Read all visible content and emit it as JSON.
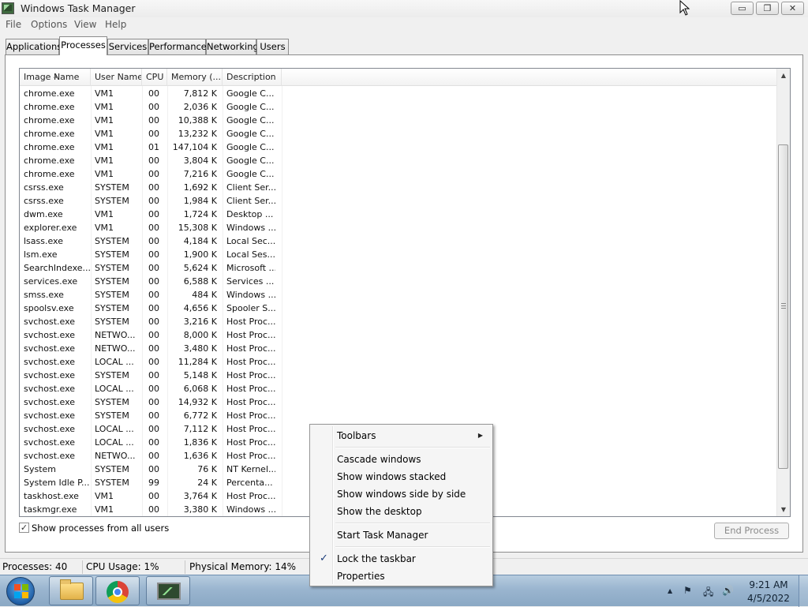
{
  "window": {
    "title": "Windows Task Manager",
    "minimize_label": "▭",
    "restore_label": "❐",
    "close_label": "✕"
  },
  "menu": [
    "File",
    "Options",
    "View",
    "Help"
  ],
  "tabs": [
    "Applications",
    "Processes",
    "Services",
    "Performance",
    "Networking",
    "Users"
  ],
  "active_tab": "Processes",
  "columns": [
    "Image Name",
    "User Name",
    "CPU",
    "Memory (...",
    "Description"
  ],
  "processes": [
    {
      "name": "chrome.exe",
      "user": "VM1",
      "cpu": "00",
      "mem": "7,812 K",
      "desc": "Google C..."
    },
    {
      "name": "chrome.exe",
      "user": "VM1",
      "cpu": "00",
      "mem": "2,036 K",
      "desc": "Google C..."
    },
    {
      "name": "chrome.exe",
      "user": "VM1",
      "cpu": "00",
      "mem": "10,388 K",
      "desc": "Google C..."
    },
    {
      "name": "chrome.exe",
      "user": "VM1",
      "cpu": "00",
      "mem": "13,232 K",
      "desc": "Google C..."
    },
    {
      "name": "chrome.exe",
      "user": "VM1",
      "cpu": "01",
      "mem": "147,104 K",
      "desc": "Google C..."
    },
    {
      "name": "chrome.exe",
      "user": "VM1",
      "cpu": "00",
      "mem": "3,804 K",
      "desc": "Google C..."
    },
    {
      "name": "chrome.exe",
      "user": "VM1",
      "cpu": "00",
      "mem": "7,216 K",
      "desc": "Google C..."
    },
    {
      "name": "csrss.exe",
      "user": "SYSTEM",
      "cpu": "00",
      "mem": "1,692 K",
      "desc": "Client Ser..."
    },
    {
      "name": "csrss.exe",
      "user": "SYSTEM",
      "cpu": "00",
      "mem": "1,984 K",
      "desc": "Client Ser..."
    },
    {
      "name": "dwm.exe",
      "user": "VM1",
      "cpu": "00",
      "mem": "1,724 K",
      "desc": "Desktop ..."
    },
    {
      "name": "explorer.exe",
      "user": "VM1",
      "cpu": "00",
      "mem": "15,308 K",
      "desc": "Windows ..."
    },
    {
      "name": "lsass.exe",
      "user": "SYSTEM",
      "cpu": "00",
      "mem": "4,184 K",
      "desc": "Local Sec..."
    },
    {
      "name": "lsm.exe",
      "user": "SYSTEM",
      "cpu": "00",
      "mem": "1,900 K",
      "desc": "Local Ses..."
    },
    {
      "name": "SearchIndexe...",
      "user": "SYSTEM",
      "cpu": "00",
      "mem": "5,624 K",
      "desc": "Microsoft ..."
    },
    {
      "name": "services.exe",
      "user": "SYSTEM",
      "cpu": "00",
      "mem": "6,588 K",
      "desc": "Services ..."
    },
    {
      "name": "smss.exe",
      "user": "SYSTEM",
      "cpu": "00",
      "mem": "484 K",
      "desc": "Windows ..."
    },
    {
      "name": "spoolsv.exe",
      "user": "SYSTEM",
      "cpu": "00",
      "mem": "4,656 K",
      "desc": "Spooler S..."
    },
    {
      "name": "svchost.exe",
      "user": "SYSTEM",
      "cpu": "00",
      "mem": "3,216 K",
      "desc": "Host Proc..."
    },
    {
      "name": "svchost.exe",
      "user": "NETWO...",
      "cpu": "00",
      "mem": "8,000 K",
      "desc": "Host Proc..."
    },
    {
      "name": "svchost.exe",
      "user": "NETWO...",
      "cpu": "00",
      "mem": "3,480 K",
      "desc": "Host Proc..."
    },
    {
      "name": "svchost.exe",
      "user": "LOCAL ...",
      "cpu": "00",
      "mem": "11,284 K",
      "desc": "Host Proc..."
    },
    {
      "name": "svchost.exe",
      "user": "SYSTEM",
      "cpu": "00",
      "mem": "5,148 K",
      "desc": "Host Proc..."
    },
    {
      "name": "svchost.exe",
      "user": "LOCAL ...",
      "cpu": "00",
      "mem": "6,068 K",
      "desc": "Host Proc..."
    },
    {
      "name": "svchost.exe",
      "user": "SYSTEM",
      "cpu": "00",
      "mem": "14,932 K",
      "desc": "Host Proc..."
    },
    {
      "name": "svchost.exe",
      "user": "SYSTEM",
      "cpu": "00",
      "mem": "6,772 K",
      "desc": "Host Proc..."
    },
    {
      "name": "svchost.exe",
      "user": "LOCAL ...",
      "cpu": "00",
      "mem": "7,112 K",
      "desc": "Host Proc..."
    },
    {
      "name": "svchost.exe",
      "user": "LOCAL ...",
      "cpu": "00",
      "mem": "1,836 K",
      "desc": "Host Proc..."
    },
    {
      "name": "svchost.exe",
      "user": "NETWO...",
      "cpu": "00",
      "mem": "1,636 K",
      "desc": "Host Proc..."
    },
    {
      "name": "System",
      "user": "SYSTEM",
      "cpu": "00",
      "mem": "76 K",
      "desc": "NT Kernel..."
    },
    {
      "name": "System Idle P...",
      "user": "SYSTEM",
      "cpu": "99",
      "mem": "24 K",
      "desc": "Percenta..."
    },
    {
      "name": "taskhost.exe",
      "user": "VM1",
      "cpu": "00",
      "mem": "3,764 K",
      "desc": "Host Proc..."
    },
    {
      "name": "taskmgr.exe",
      "user": "VM1",
      "cpu": "00",
      "mem": "3,380 K",
      "desc": "Windows ..."
    }
  ],
  "show_all_users": {
    "label": "Show processes from all users",
    "checked": true,
    "check_glyph": "✓"
  },
  "end_process_label": "End Process",
  "status": {
    "processes": "Processes: 40",
    "cpu": "CPU Usage: 1%",
    "memory": "Physical Memory: 14%"
  },
  "context_menu": {
    "toolbars": "Toolbars",
    "submenu_arrow": "▶",
    "cascade": "Cascade windows",
    "stacked": "Show windows stacked",
    "side_by_side": "Show windows side by side",
    "desktop": "Show the desktop",
    "task_manager": "Start Task Manager",
    "lock": "Lock the taskbar",
    "lock_checked": true,
    "check_glyph": "✓",
    "properties": "Properties"
  },
  "taskbar": {
    "time": "9:21 AM",
    "date": "4/5/2022",
    "tray_arrow": "▲",
    "pinned": [
      "windows-explorer-icon",
      "chrome-icon",
      "task-manager-icon"
    ],
    "start_colors": [
      "#f25022",
      "#7fba00",
      "#00a4ef",
      "#ffb900"
    ]
  },
  "colors": {
    "taskbar": "#9ab5cf",
    "window_bg": "#f0f0f0",
    "menu_bg": "#f5f5f5"
  }
}
